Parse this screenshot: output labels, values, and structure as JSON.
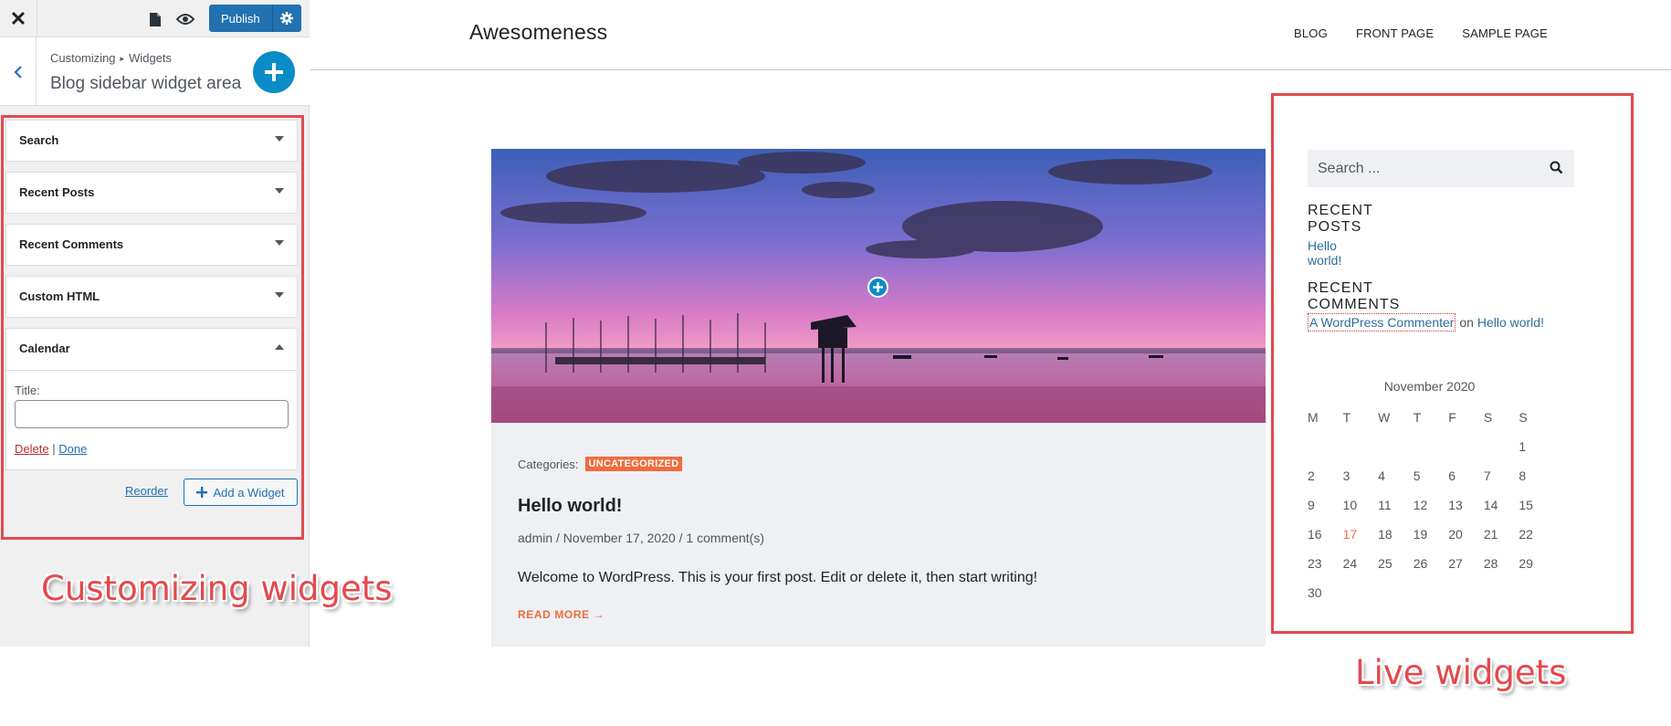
{
  "customizer": {
    "topbar": {
      "close_icon": "close-icon",
      "page_icon": "document-icon",
      "preview_icon": "eye-icon",
      "publish_label": "Publish",
      "settings_icon": "gear-icon"
    },
    "header": {
      "breadcrumb_root": "Customizing",
      "breadcrumb_section": "Widgets",
      "title": "Blog sidebar widget area"
    },
    "widgets": [
      {
        "label": "Search"
      },
      {
        "label": "Recent Posts"
      },
      {
        "label": "Recent Comments"
      },
      {
        "label": "Custom HTML"
      },
      {
        "label": "Calendar"
      }
    ],
    "calendar_form": {
      "title_label": "Title:",
      "title_value": "",
      "delete_label": "Delete",
      "separator": "|",
      "done_label": "Done"
    },
    "reorder_label": "Reorder",
    "add_widget_label": "Add a Widget"
  },
  "annotations": {
    "left_label": "Customizing widgets",
    "right_label": "Live widgets",
    "highlight_color": "#e14a4f"
  },
  "site": {
    "title": "Awesomeness",
    "nav": [
      "BLOG",
      "FRONT PAGE",
      "SAMPLE PAGE"
    ]
  },
  "post": {
    "categories_label": "Categories:",
    "category": "UNCATEGORIZED",
    "title": "Hello world!",
    "meta": "admin / November 17, 2020 / 1 comment(s)",
    "excerpt": "Welcome to WordPress. This is your first post. Edit or delete it, then start writing!",
    "read_more": "READ MORE →"
  },
  "live_sidebar": {
    "search_placeholder": "Search ...",
    "recent_posts_heading": "RECENT POSTS",
    "recent_post": "Hello world!",
    "recent_comments_heading": "RECENT COMMENTS",
    "comment_author": "A WordPress Commenter",
    "comment_on": "on",
    "comment_post": "Hello world!",
    "calendar": {
      "caption": "November 2020",
      "weekdays": [
        "M",
        "T",
        "W",
        "T",
        "F",
        "S",
        "S"
      ],
      "weeks": [
        [
          "",
          "",
          "",
          "",
          "",
          "",
          "1"
        ],
        [
          "2",
          "3",
          "4",
          "5",
          "6",
          "7",
          "8"
        ],
        [
          "9",
          "10",
          "11",
          "12",
          "13",
          "14",
          "15"
        ],
        [
          "16",
          "17",
          "18",
          "19",
          "20",
          "21",
          "22"
        ],
        [
          "23",
          "24",
          "25",
          "26",
          "27",
          "28",
          "29"
        ],
        [
          "30",
          "",
          "",
          "",
          "",
          "",
          ""
        ]
      ],
      "today": "17"
    }
  },
  "colors": {
    "accent_blue": "#2271b1",
    "add_circle": "#0a8cc7",
    "orange": "#f06b3d",
    "link": "#2c6e9b"
  }
}
